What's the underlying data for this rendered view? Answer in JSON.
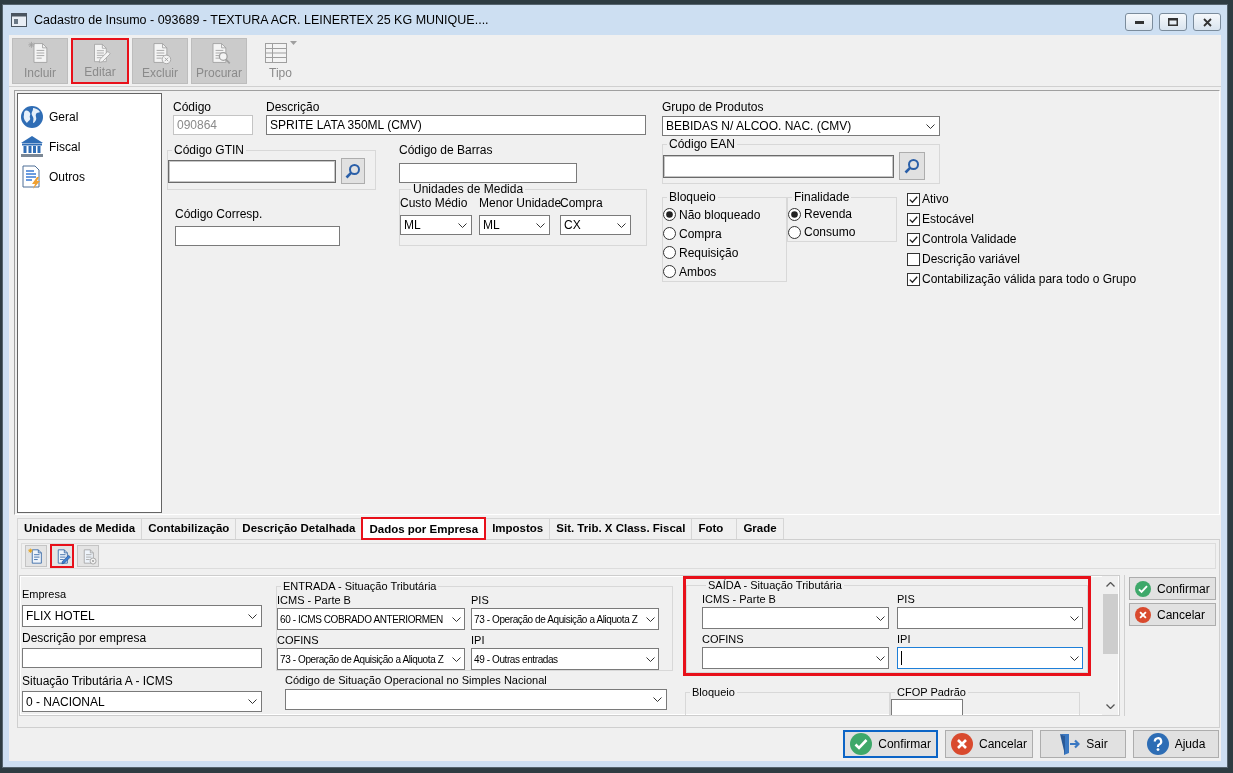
{
  "window": {
    "title": "Cadastro de Insumo - 093689 - TEXTURA ACR. LEINERTEX 25 KG MUNIQUE...."
  },
  "toolbar": [
    {
      "label": "Incluir",
      "kind": "new",
      "disabled": true,
      "highlighted": false
    },
    {
      "label": "Editar",
      "kind": "edit",
      "disabled": true,
      "highlighted": true
    },
    {
      "label": "Excluir",
      "kind": "delete",
      "disabled": true,
      "highlighted": false
    },
    {
      "label": "Procurar",
      "kind": "search",
      "disabled": true,
      "highlighted": false
    },
    {
      "label": "Tipo",
      "kind": "type-menu",
      "disabled": true,
      "highlighted": false
    }
  ],
  "sidebar": {
    "items": [
      {
        "label": "Geral",
        "kind": "globe"
      },
      {
        "label": "Fiscal",
        "kind": "bank"
      },
      {
        "label": "Outros",
        "kind": "document"
      }
    ]
  },
  "general": {
    "codigo": {
      "label": "Código",
      "value": "090864",
      "disabled": true
    },
    "descricao": {
      "label": "Descrição",
      "value": "SPRITE LATA 350ML (CMV)"
    },
    "grupo_produtos": {
      "label": "Grupo de Produtos",
      "value": "BEBIDAS N/ ALCOO. NAC. (CMV)"
    },
    "codigo_gtin": {
      "label": "Código GTIN"
    },
    "codigo_barras": {
      "label": "Código de Barras"
    },
    "codigo_ean": {
      "label": "Código EAN"
    },
    "codigo_corresp": {
      "label": "Código Corresp."
    },
    "unidades_medida": {
      "title": "Unidades de Medida",
      "fields": [
        {
          "label": "Custo Médio",
          "value": "ML"
        },
        {
          "label": "Menor Unidade",
          "value": "ML"
        },
        {
          "label": "Compra",
          "value": "CX"
        }
      ]
    },
    "bloqueio": {
      "title": "Bloqueio",
      "options": [
        {
          "label": "Não bloqueado",
          "selected": true
        },
        {
          "label": "Compra",
          "selected": false
        },
        {
          "label": "Requisição",
          "selected": false
        },
        {
          "label": "Ambos",
          "selected": false
        }
      ]
    },
    "finalidade": {
      "title": "Finalidade",
      "options": [
        {
          "label": "Revenda",
          "selected": true
        },
        {
          "label": "Consumo",
          "selected": false
        }
      ]
    },
    "flags": [
      {
        "label": "Ativo",
        "checked": true
      },
      {
        "label": "Estocável",
        "checked": true
      },
      {
        "label": "Controla Validade",
        "checked": true
      },
      {
        "label": "Descrição variável",
        "checked": false
      },
      {
        "label": "Contabilização válida para todo o Grupo",
        "checked": true
      }
    ]
  },
  "tabs": [
    {
      "label": "Unidades de Medida",
      "selected": false,
      "highlighted": false
    },
    {
      "label": "Contabilização",
      "selected": false,
      "highlighted": false
    },
    {
      "label": "Descrição Detalhada",
      "selected": false,
      "highlighted": false
    },
    {
      "label": "Dados por Empresa",
      "selected": true,
      "highlighted": true
    },
    {
      "label": "Impostos",
      "selected": false,
      "highlighted": false
    },
    {
      "label": "Sit. Trib. X Class. Fiscal",
      "selected": false,
      "highlighted": false
    },
    {
      "label": "Foto",
      "selected": false,
      "highlighted": false
    },
    {
      "label": "Grade",
      "selected": false,
      "highlighted": false
    }
  ],
  "tab_toolbar": [
    {
      "kind": "new",
      "disabled": false,
      "highlighted": false
    },
    {
      "kind": "edit",
      "disabled": false,
      "highlighted": true
    },
    {
      "kind": "delete",
      "disabled": true,
      "highlighted": false
    }
  ],
  "company": {
    "empresa": {
      "label": "Empresa",
      "value": "FLIX HOTEL"
    },
    "descricao_empresa": {
      "label": "Descrição por empresa"
    },
    "situacao_icms": {
      "label": "Situação Tributária A - ICMS",
      "value": "0 - NACIONAL"
    },
    "entrada": {
      "title": "ENTRADA - Situação Tributária",
      "highlighted": false,
      "fields": [
        {
          "label": "ICMS - Parte B",
          "value": "60 - ICMS COBRADO ANTERIORMEN",
          "focused": false
        },
        {
          "label": "PIS",
          "value": "73 - Operação de Aquisição a Aliquota Z",
          "focused": false
        },
        {
          "label": "COFINS",
          "value": "73 - Operação de Aquisição a Aliquota Z",
          "focused": false
        },
        {
          "label": "IPI",
          "value": "49 - Outras entradas",
          "focused": false
        }
      ]
    },
    "simples_nacional": {
      "label": "Código de Situação Operacional no Simples Nacional"
    },
    "saida": {
      "title": "SAÍDA - Situação Tributária",
      "highlighted": true,
      "fields": [
        {
          "label": "ICMS - Parte B",
          "focused": false
        },
        {
          "label": "PIS",
          "focused": false
        },
        {
          "label": "COFINS",
          "focused": false
        },
        {
          "label": "IPI",
          "focused": true
        }
      ]
    },
    "bloqueio": {
      "title": "Bloqueio"
    },
    "cfop_padrao": {
      "title": "CFOP Padrão"
    }
  },
  "side_buttons": [
    {
      "label": "Confirmar",
      "kind": "confirm"
    },
    {
      "label": "Cancelar",
      "kind": "cancel"
    }
  ],
  "footer_buttons": [
    {
      "label": "Confirmar",
      "kind": "confirm",
      "focused": true
    },
    {
      "label": "Cancelar",
      "kind": "cancel",
      "focused": false
    },
    {
      "label": "Sair",
      "kind": "exit",
      "focused": false
    },
    {
      "label": "Ajuda",
      "kind": "help",
      "focused": false
    }
  ]
}
